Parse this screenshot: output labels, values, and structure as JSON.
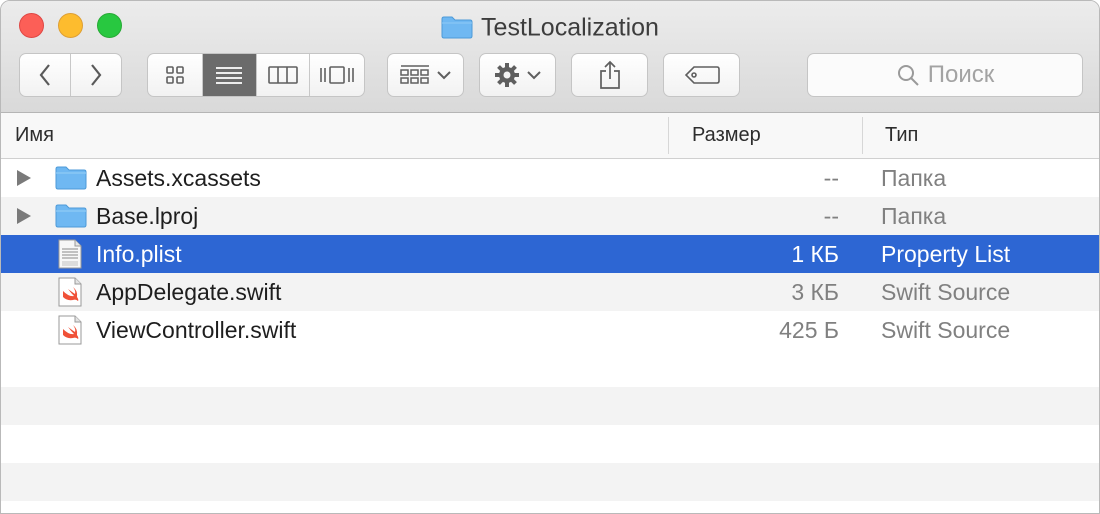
{
  "window": {
    "title": "TestLocalization"
  },
  "toolbar": {
    "back": "back",
    "forward": "forward",
    "views": [
      "icon-view",
      "list-view",
      "column-view",
      "cover-flow-view"
    ],
    "active_view": "list-view",
    "search_placeholder": "Поиск"
  },
  "columns": {
    "name": "Имя",
    "size": "Размер",
    "kind": "Тип"
  },
  "files": [
    {
      "name": "Assets.xcassets",
      "size": "--",
      "kind": "Папка",
      "icon": "folder-icon",
      "expandable": true,
      "selected": false
    },
    {
      "name": "Base.lproj",
      "size": "--",
      "kind": "Папка",
      "icon": "folder-icon",
      "expandable": true,
      "selected": false
    },
    {
      "name": "Info.plist",
      "size": "1 КБ",
      "kind": "Property List",
      "icon": "plist-file-icon",
      "expandable": false,
      "selected": true
    },
    {
      "name": "AppDelegate.swift",
      "size": "3 КБ",
      "kind": "Swift Source",
      "icon": "swift-file-icon",
      "expandable": false,
      "selected": false
    },
    {
      "name": "ViewController.swift",
      "size": "425 Б",
      "kind": "Swift Source",
      "icon": "swift-file-icon",
      "expandable": false,
      "selected": false
    }
  ],
  "colors": {
    "selection": "#2d66d3",
    "folder": "#6fb8f2"
  }
}
